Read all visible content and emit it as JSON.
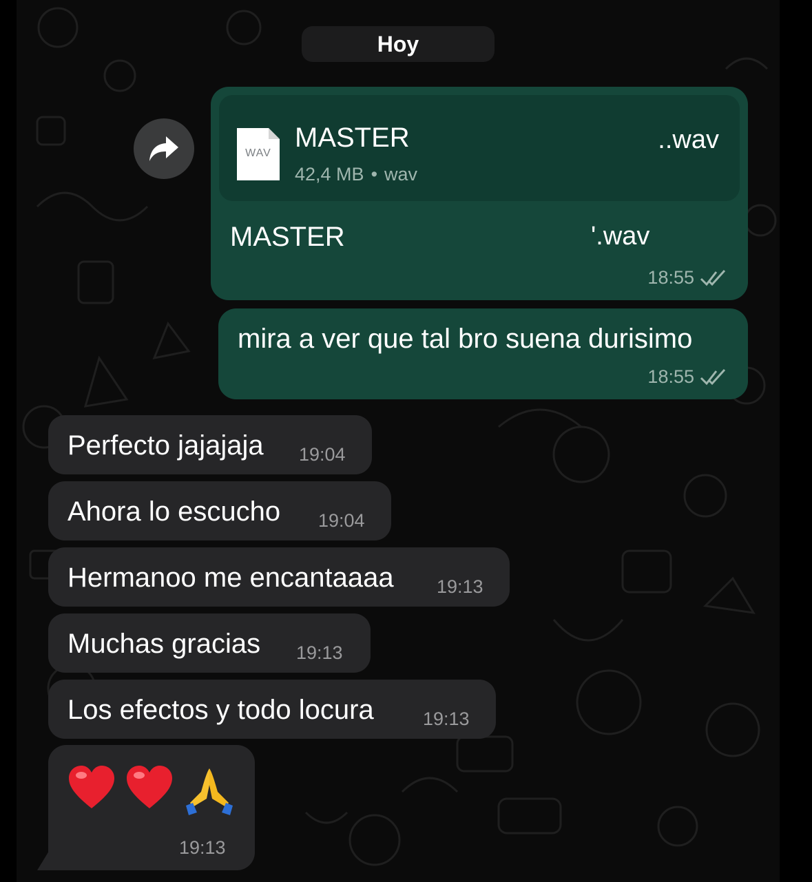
{
  "date_separator": "Hoy",
  "outgoing": [
    {
      "file": {
        "icon_label": "WAV",
        "name_start": "MASTER",
        "name_end": "..wav",
        "size": "42,4 MB",
        "type": "wav"
      },
      "caption_start": "MASTER",
      "caption_end": "'.wav",
      "time": "18:55",
      "status_icon": "double-check-icon"
    },
    {
      "text": "mira a ver que tal bro suena durisimo",
      "time": "18:55",
      "status_icon": "double-check-icon"
    }
  ],
  "incoming": [
    {
      "text": "Perfecto jajajaja",
      "time": "19:04"
    },
    {
      "text": "Ahora lo escucho",
      "time": "19:04"
    },
    {
      "text": "Hermanoo me encantaaaa",
      "time": "19:13"
    },
    {
      "text": "Muchas gracias",
      "time": "19:13"
    },
    {
      "text": "Los efectos y todo locura",
      "time": "19:13"
    },
    {
      "emojis": [
        "❤️",
        "❤️",
        "🙏"
      ],
      "time": "19:13"
    }
  ],
  "colors": {
    "outgoing_bubble": "#15473a",
    "incoming_bubble": "#262628",
    "background": "#0b0b0b"
  }
}
